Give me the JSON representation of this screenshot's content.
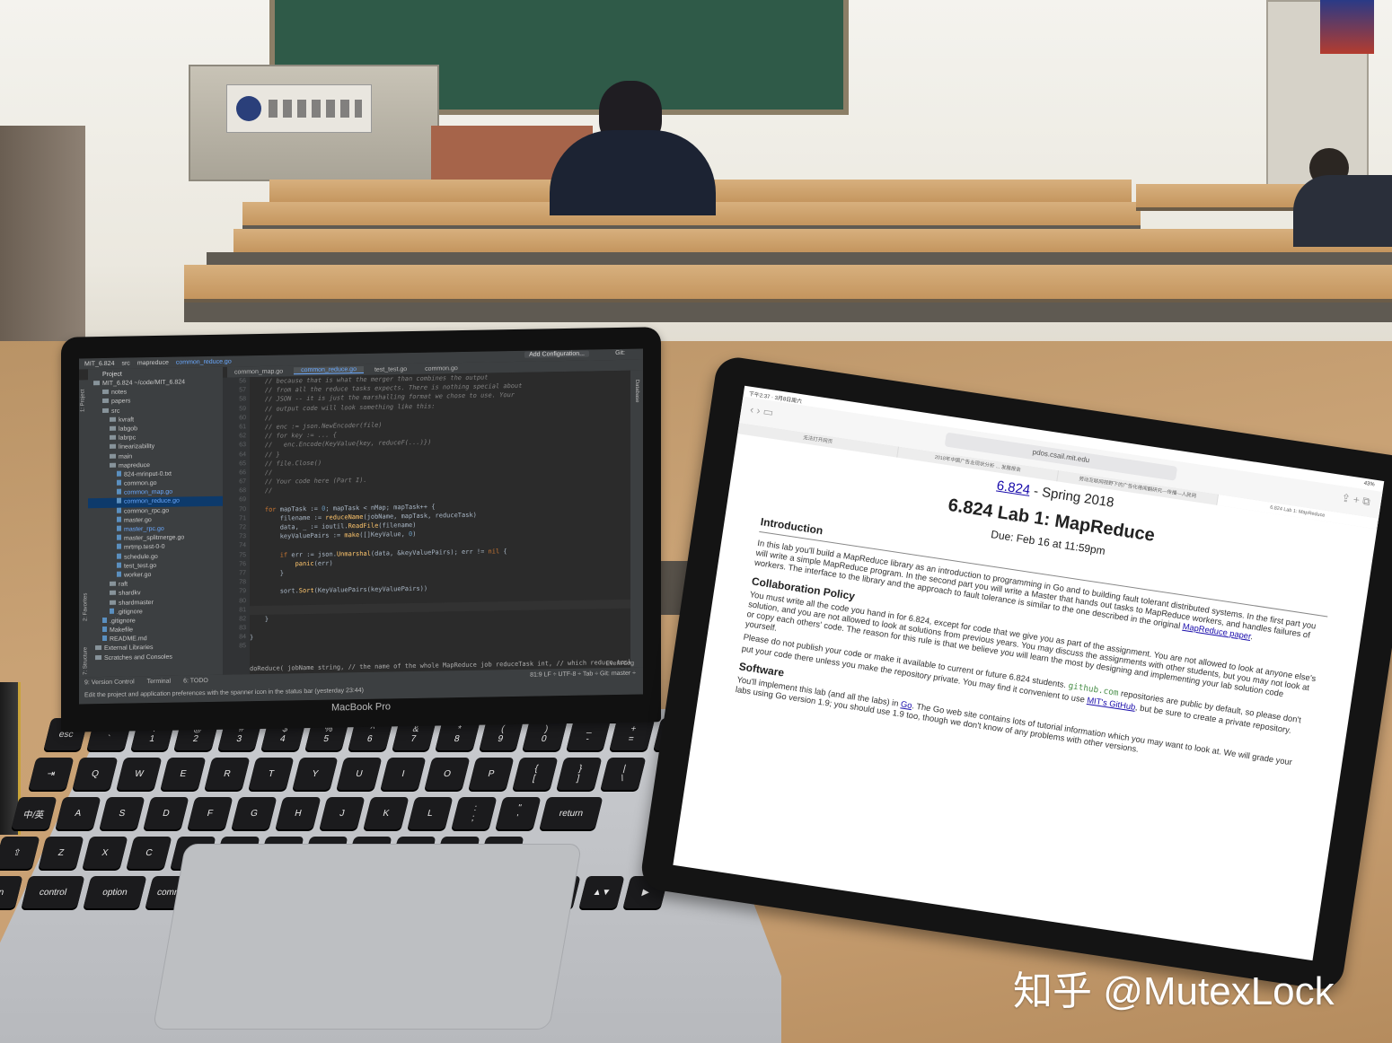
{
  "laptop": {
    "brand": "MacBook Pro",
    "navbar": {
      "crumbs": [
        "MIT_6.824",
        "src",
        "mapreduce",
        "common_reduce.go"
      ],
      "config_button": "Add Configuration...",
      "git": "Git:"
    },
    "tabs": [
      "common_map.go",
      "common_reduce.go",
      "test_test.go",
      "common.go"
    ],
    "project": {
      "header": "Project",
      "root": "MIT_6.824 ~/code/MIT_6.824",
      "items": [
        "notes",
        "papers",
        "src",
        "kvraft",
        "labgob",
        "labrpc",
        "linearizability",
        "main",
        "mapreduce",
        "824-mrinput-0.txt",
        "common.go",
        "common_map.go",
        "common_reduce.go",
        "common_rpc.go",
        "master.go",
        "master_rpc.go",
        "master_splitmerge.go",
        "mrtmp.test-0-0",
        "schedule.go",
        "test_test.go",
        "worker.go",
        "raft",
        "shardkv",
        "shardmaster",
        ".gitignore",
        ".gitignore",
        "Makefile",
        "README.md",
        "External Libraries",
        "Scratches and Consoles"
      ]
    },
    "line_numbers": [
      "56",
      "57",
      "58",
      "59",
      "60",
      "61",
      "62",
      "63",
      "64",
      "65",
      "66",
      "67",
      "68",
      "69",
      "70",
      "71",
      "72",
      "73",
      "74",
      "75",
      "76",
      "77",
      "78",
      "79",
      "80",
      "81",
      "82",
      "83",
      "84",
      "85"
    ],
    "code": [
      "    // because that is what the merger than combines the output",
      "    // from all the reduce tasks expects. There is nothing special about",
      "    // JSON -- it is just the marshalling format we chose to use. Your",
      "    // output code will look something like this:",
      "    //",
      "    // enc := json.NewEncoder(file)",
      "    // for key := ... {",
      "    //   enc.Encode(KeyValue{key, reduceF(...)})",
      "    // }",
      "    // file.Close()",
      "    //",
      "    // Your code here (Part I).",
      "    //",
      "",
      "    for mapTask := 0; mapTask < nMap; mapTask++ {",
      "        filename := reduceName(jobName, mapTask, reduceTask)",
      "        data, _ := ioutil.ReadFile(filename)",
      "        keyValuePairs := make([]KeyValue, 0)",
      "",
      "        if err := json.Unmarshal(data, &keyValuePairs); err != nil {",
      "            panic(err)",
      "        }",
      "",
      "        sort.Sort(KeyValuePairs(keyValuePairs))",
      "",
      "",
      "    }",
      "",
      "}",
      ""
    ],
    "hint": "doReduce( jobName string, // the name of the whole MapReduce job  reduceTask int, // which reduce task this is  outFile string, // write the outp",
    "event_log": "Event Log",
    "status_right": "81:9  LF ÷  UTF-8 ÷  Tab ÷  Git: master ÷",
    "tools": [
      "9: Version Control",
      "Terminal",
      "6: TODO"
    ],
    "status_msg": "Edit the project and application preferences with the spanner icon in the status bar (yesterday 23:44)",
    "side_labels": [
      "1: Project",
      "2: Favorites",
      "7: Structure"
    ],
    "right_label": "Database",
    "keys": {
      "row1": [
        "esc",
        "~\n`",
        "!\n1",
        "@\n2",
        "#\n3",
        "$\n4",
        "%\n5",
        "^\n6",
        "&\n7",
        "*\n8",
        "(\n9",
        ")\n0",
        "_\n-",
        "+\n=",
        "delete"
      ],
      "row2": [
        "⇥",
        "Q",
        "W",
        "E",
        "R",
        "T",
        "Y",
        "U",
        "I",
        "O",
        "P",
        "{\n[",
        "}\n]",
        "|\n\\"
      ],
      "row3": [
        "中/英",
        "A",
        "S",
        "D",
        "F",
        "G",
        "H",
        "J",
        "K",
        "L",
        ":\n;",
        "\"\n'",
        "return"
      ],
      "row4": [
        "⇧",
        "Z",
        "X",
        "C",
        "V",
        "B",
        "N",
        "M",
        "<\n,",
        ">\n.",
        "?\n/",
        "⇧"
      ],
      "row5": [
        "fn",
        "control",
        "option",
        "command",
        "",
        "command",
        "option",
        "◀",
        "▲▼",
        "▶"
      ]
    }
  },
  "ipad": {
    "time": "下午2:37 · 3月8日周六",
    "battery": "43%",
    "url": "pdos.csail.mit.edu",
    "tabs": [
      "无法打开网页",
      "2018年中国广告业现状分析 ... 发展报告",
      "劳动互联网视野下的广告化倦闻翻研究—传播—人民网",
      "6.824 Lab 1: MapReduce"
    ],
    "course_link": "6.824",
    "course_rest": " - Spring 2018",
    "title": "6.824 Lab 1: MapReduce",
    "due": "Due: Feb 16 at 11:59pm",
    "sections": [
      {
        "heading": "Introduction",
        "text": "In this lab you'll build a MapReduce library as an introduction to programming in Go and to building fault tolerant distributed systems. In the first part you will write a simple MapReduce program. In the second part you will write a Master that hands out tasks to MapReduce workers, and handles failures of workers. The interface to the library and the approach to fault tolerance is similar to the one described in the original ",
        "link": "MapReduce paper",
        "after": "."
      },
      {
        "heading": "Collaboration Policy",
        "text": "You must write all the code you hand in for 6.824, except for code that we give you as part of the assignment. You are not allowed to look at anyone else's solution, and you are not allowed to look at solutions from previous years. You may discuss the assignments with other students, but you may not look at or copy each others' code. The reason for this rule is that we believe you will learn the most by designing and implementing your lab solution code yourself.",
        "text2": "Please do not publish your code or make it available to current or future 6.824 students. ",
        "code": "github.com",
        "text3": " repositories are public by default, so please don't put your code there unless you make the repository private. You may find it convenient to use ",
        "link2": "MIT's GitHub",
        "text4": ", but be sure to create a private repository."
      },
      {
        "heading": "Software",
        "text": "You'll implement this lab (and all the labs) in ",
        "link": "Go",
        "after": ". The Go web site contains lots of tutorial information which you may want to look at. We will grade your labs using Go version 1.9; you should use 1.9 too, though we don't know of any problems with other versions."
      }
    ]
  },
  "watermark": "知乎 @MutexLock",
  "colors": {
    "wood": "#c9a275",
    "ide_bg": "#2b2b2b",
    "link": "#1a0dab",
    "keyword": "#cc7832",
    "function": "#ffc66d"
  }
}
